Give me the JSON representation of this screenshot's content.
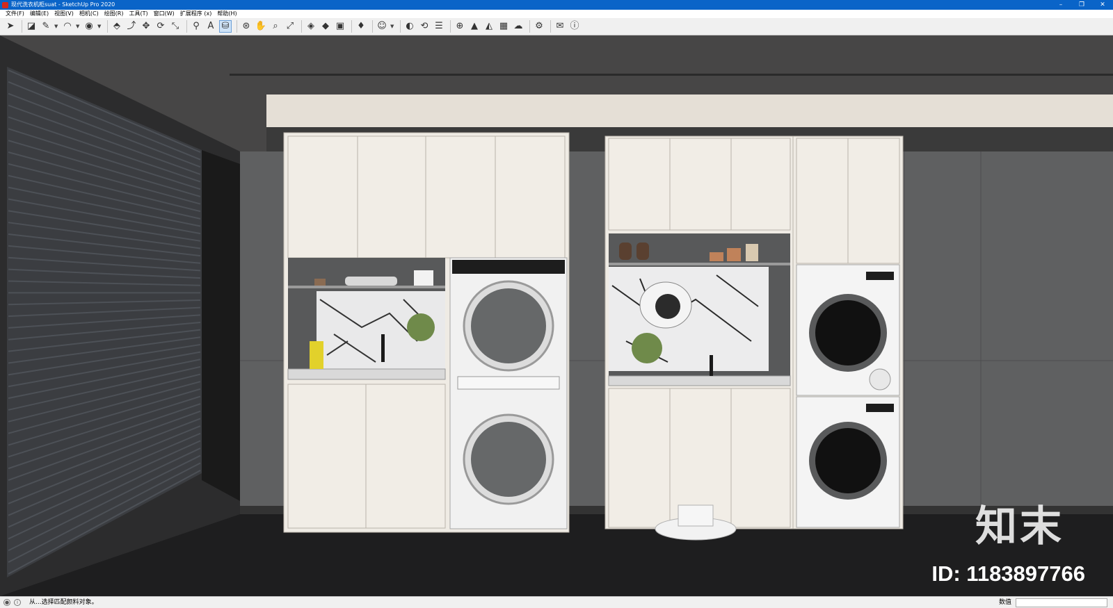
{
  "window": {
    "title": "现代洗衣机柜suat - SketchUp Pro 2020",
    "min": "–",
    "max": "❐",
    "close": "✕"
  },
  "menu": [
    "文件(F)",
    "编辑(E)",
    "视图(V)",
    "相机(C)",
    "绘图(R)",
    "工具(T)",
    "窗口(W)",
    "扩展程序 (x)",
    "帮助(H)"
  ],
  "toolbar": {
    "groups": [
      [
        {
          "name": "select-icon",
          "glyph": "➤"
        }
      ],
      [
        {
          "name": "eraser-icon",
          "glyph": "◪"
        },
        {
          "name": "pencil-icon",
          "glyph": "✎",
          "drop": true
        },
        {
          "name": "arc-icon",
          "glyph": "◠",
          "drop": true
        },
        {
          "name": "shape-icon",
          "glyph": "◉",
          "drop": true
        }
      ],
      [
        {
          "name": "push-pull-icon",
          "glyph": "⬘"
        },
        {
          "name": "follow-me-icon",
          "glyph": "⤴"
        },
        {
          "name": "move-icon",
          "glyph": "✥"
        },
        {
          "name": "rotate-icon",
          "glyph": "⟳"
        },
        {
          "name": "scale-icon",
          "glyph": "⤡"
        }
      ],
      [
        {
          "name": "tape-measure-icon",
          "glyph": "⚲"
        },
        {
          "name": "text-icon",
          "glyph": "A"
        },
        {
          "name": "paint-bucket-icon",
          "glyph": "⛁",
          "selected": true
        }
      ],
      [
        {
          "name": "orbit-icon",
          "glyph": "⊛"
        },
        {
          "name": "pan-icon",
          "glyph": "✋"
        },
        {
          "name": "zoom-icon",
          "glyph": "⌕"
        },
        {
          "name": "zoom-extents-icon",
          "glyph": "⤢"
        }
      ],
      [
        {
          "name": "warehouse-icon",
          "glyph": "◈"
        },
        {
          "name": "extension-warehouse-icon",
          "glyph": "◆"
        },
        {
          "name": "layout-icon",
          "glyph": "▣"
        }
      ],
      [
        {
          "name": "ruby-icon",
          "glyph": "♦"
        }
      ],
      [
        {
          "name": "account-icon",
          "glyph": "☺",
          "drop": true
        }
      ],
      [
        {
          "name": "sketchup-logo-icon",
          "glyph": "◐"
        },
        {
          "name": "sync-icon",
          "glyph": "⟲"
        },
        {
          "name": "components-icon",
          "glyph": "☰"
        }
      ],
      [
        {
          "name": "add-location-icon",
          "glyph": "⊕"
        },
        {
          "name": "terrain-icon",
          "glyph": "▲"
        },
        {
          "name": "sandbox-icon",
          "glyph": "◭"
        },
        {
          "name": "texture-icon",
          "glyph": "▦"
        },
        {
          "name": "upload-icon",
          "glyph": "☁"
        }
      ],
      [
        {
          "name": "settings-icon",
          "glyph": "⚙"
        }
      ],
      [
        {
          "name": "mail-icon",
          "glyph": "✉"
        },
        {
          "name": "info-icon",
          "glyph": "ⓘ"
        }
      ]
    ]
  },
  "colors": {
    "cabinet": "#efebe4",
    "cabinet_line": "#b9b3aa",
    "wall_dark": "#454444",
    "wall_tile": "#5f6061",
    "floor": "#1e1e1f",
    "soffit": "#e5dfd6",
    "niche": "#58595a",
    "washer_body": "#f1f1f1",
    "drum": "#555759"
  },
  "watermark": {
    "logo": "知末",
    "id": "ID: 1183897766"
  },
  "status": {
    "text": "从...选择匹配颜料对象。",
    "measure_label": "数值",
    "measure_value": ""
  }
}
